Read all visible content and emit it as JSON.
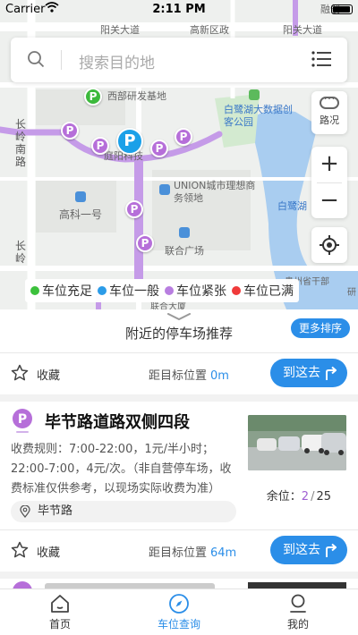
{
  "status_bar": {
    "carrier": "Carrier",
    "time": "2:11 PM"
  },
  "map": {
    "labels": {
      "yangguan_top": "阳关大道",
      "gaoxin": "高新区政",
      "yangguan_right": "阳关大道",
      "rongsheng": "融创",
      "xibu": "西部研发基地",
      "changling_south": "长岭南路",
      "bailu_park": "白鹭湖大数据创客公园",
      "tingyang": "庭阳科技",
      "union": "UNION城市理想商务领地",
      "gaoke": "高科一号",
      "bailu_lake": "白鹭湖",
      "lianhe": "联合广场",
      "changling": "长岭",
      "guizhou": "贵州省干部",
      "yanjiu": "研",
      "lianhe_bld": "联合大厦"
    },
    "pin_letter": "P"
  },
  "search": {
    "placeholder": "搜索目的地",
    "icon": "search-icon",
    "menu_icon": "list-menu-icon"
  },
  "controls": {
    "traffic_label": "路况",
    "zoom_in": "+",
    "zoom_out": "−"
  },
  "legend": [
    {
      "label": "车位充足",
      "color": "#3cc13c"
    },
    {
      "label": "车位一般",
      "color": "#2b9ce8"
    },
    {
      "label": "车位紧张",
      "color": "#b87ee0"
    },
    {
      "label": "车位已满",
      "color": "#f03a3a"
    }
  ],
  "sheet": {
    "title": "附近的停车场推荐",
    "more_button": "更多排序",
    "first_row": {
      "fav_label": "收藏",
      "dist_label": "距目标位置",
      "dist_value": "0m",
      "go_label": "到这去"
    },
    "lot": {
      "name": "毕节路道路双侧四段",
      "fee": "收费规则：7:00-22:00，1元/半小时；22:00-7:00，4元/次。（非自营停车场，收费标准仅供参考，以现场实际收费为准）",
      "remain_label": "余位：",
      "remain": "2",
      "slash": "/",
      "total": "25",
      "address": "毕节路",
      "fav_label": "收藏",
      "dist_label": "距目标位置",
      "dist_value": "64m",
      "go_label": "到这去"
    }
  },
  "tabs": [
    {
      "label": "首页",
      "icon": "home-icon"
    },
    {
      "label": "车位查询",
      "icon": "compass-icon"
    },
    {
      "label": "我的",
      "icon": "user-icon"
    }
  ],
  "colors": {
    "accent": "#2b8ee8",
    "route": "#c59be8",
    "pin_purple": "#b66fd9"
  }
}
